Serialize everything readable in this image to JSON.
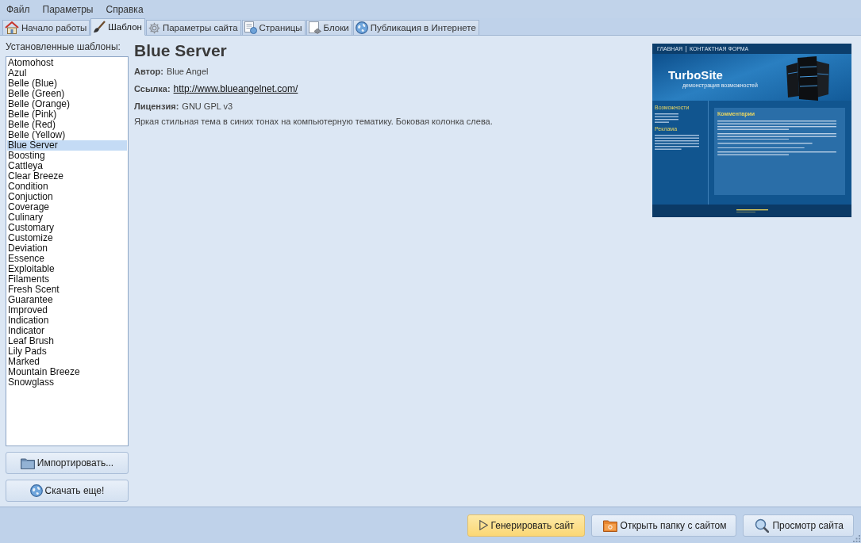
{
  "menu": [
    {
      "label": "Файл"
    },
    {
      "label": "Параметры"
    },
    {
      "label": "Справка"
    }
  ],
  "tabs": [
    {
      "label": "Начало работы",
      "selected": false
    },
    {
      "label": "Шаблон",
      "selected": true
    },
    {
      "label": "Параметры сайта",
      "selected": false
    },
    {
      "label": "Страницы",
      "selected": false
    },
    {
      "label": "Блоки",
      "selected": false
    },
    {
      "label": "Публикация в Интернете",
      "selected": false
    }
  ],
  "templates": {
    "label": "Установленные шаблоны:",
    "items": [
      {
        "name": "Atomohost",
        "selected": false
      },
      {
        "name": "Azul",
        "selected": false
      },
      {
        "name": "Belle (Blue)",
        "selected": false
      },
      {
        "name": "Belle (Green)",
        "selected": false
      },
      {
        "name": "Belle (Orange)",
        "selected": false
      },
      {
        "name": "Belle (Pink)",
        "selected": false
      },
      {
        "name": "Belle (Red)",
        "selected": false
      },
      {
        "name": "Belle (Yellow)",
        "selected": false
      },
      {
        "name": "Blue Server",
        "selected": true
      },
      {
        "name": "Boosting",
        "selected": false
      },
      {
        "name": "Cattleya",
        "selected": false
      },
      {
        "name": "Clear Breeze",
        "selected": false
      },
      {
        "name": "Condition",
        "selected": false
      },
      {
        "name": "Conjuction",
        "selected": false
      },
      {
        "name": "Coverage",
        "selected": false
      },
      {
        "name": "Culinary",
        "selected": false
      },
      {
        "name": "Customary",
        "selected": false
      },
      {
        "name": "Customize",
        "selected": false
      },
      {
        "name": "Deviation",
        "selected": false
      },
      {
        "name": "Essence",
        "selected": false
      },
      {
        "name": "Exploitable",
        "selected": false
      },
      {
        "name": "Filaments",
        "selected": false
      },
      {
        "name": "Fresh Scent",
        "selected": false
      },
      {
        "name": "Guarantee",
        "selected": false
      },
      {
        "name": "Improved",
        "selected": false
      },
      {
        "name": "Indication",
        "selected": false
      },
      {
        "name": "Indicator",
        "selected": false
      },
      {
        "name": "Leaf Brush",
        "selected": false
      },
      {
        "name": "Lily Pads",
        "selected": false
      },
      {
        "name": "Marked",
        "selected": false
      },
      {
        "name": "Mountain Breeze",
        "selected": false
      },
      {
        "name": "Snowglass",
        "selected": false
      }
    ]
  },
  "left_buttons": [
    {
      "label": "Импортировать..."
    },
    {
      "label": "Скачать еще!"
    }
  ],
  "details": {
    "title": "Blue Server",
    "fields": [
      {
        "kind": "text",
        "label": "Автор:",
        "value": "Blue Angel"
      },
      {
        "kind": "link",
        "label": "Ссылка:",
        "value": "http://www.blueangelnet.com/"
      },
      {
        "kind": "text",
        "label": "Лицензия:",
        "value": "GNU GPL v3"
      }
    ],
    "description": "Яркая стильная тема в синих тонах на компьютерную тематику. Боковая колонка слева."
  },
  "preview": {
    "nav": [
      "ГЛАВНАЯ",
      "КОНТАКТНАЯ ФОРМА"
    ],
    "logo": "TurboSite",
    "slogan": "демонстрация возможностей",
    "sidebar_headings": [
      "Возможности",
      "Реклама"
    ],
    "content_heading": "Комментарии"
  },
  "footer_buttons": [
    {
      "label": "Генерировать сайт",
      "highlighted": true
    },
    {
      "label": "Открыть папку с сайтом",
      "highlighted": false
    },
    {
      "label": "Просмотр сайта",
      "highlighted": false
    }
  ]
}
